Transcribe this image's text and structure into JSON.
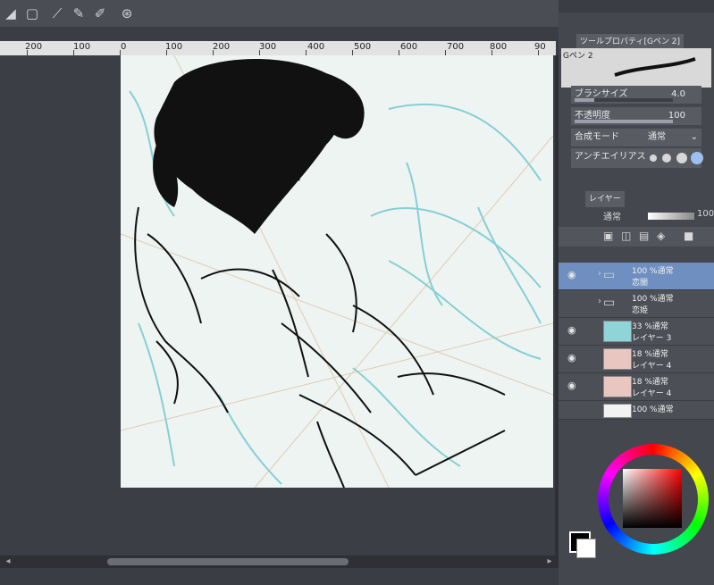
{
  "ruler": {
    "labels": [
      "200",
      "100",
      "0",
      "100",
      "200",
      "300",
      "400",
      "500",
      "600",
      "700",
      "800",
      "90"
    ]
  },
  "tool_property": {
    "tab_label": "ツールプロパティ[Gペン 2]",
    "brush_name": "Gペン 2",
    "brush_size_label": "ブラシサイズ",
    "brush_size_value": "4.0",
    "opacity_label": "不透明度",
    "opacity_value": "100",
    "blend_mode_label": "合成モード",
    "blend_mode_value": "通常",
    "antialias_label": "アンチエイリアス"
  },
  "layer_panel": {
    "tab_label": "レイヤー",
    "blend_mode": "通常",
    "opacity": "100",
    "layers": [
      {
        "pct": "100 %通常",
        "name": "恋闇",
        "type": "folder"
      },
      {
        "pct": "100 %通常",
        "name": "恋姫",
        "type": "folder"
      },
      {
        "pct": "33 %通常",
        "name": "レイヤー 3",
        "type": "layer"
      },
      {
        "pct": "18 %通常",
        "name": "レイヤー 4",
        "type": "layer"
      },
      {
        "pct": "18 %通常",
        "name": "レイヤー 4",
        "type": "layer"
      },
      {
        "pct": "100 %通常",
        "name": "",
        "type": "layer"
      }
    ]
  },
  "colors": {
    "fg": "#000000",
    "bg": "#ffffff",
    "accent": "#6e8fbf"
  }
}
